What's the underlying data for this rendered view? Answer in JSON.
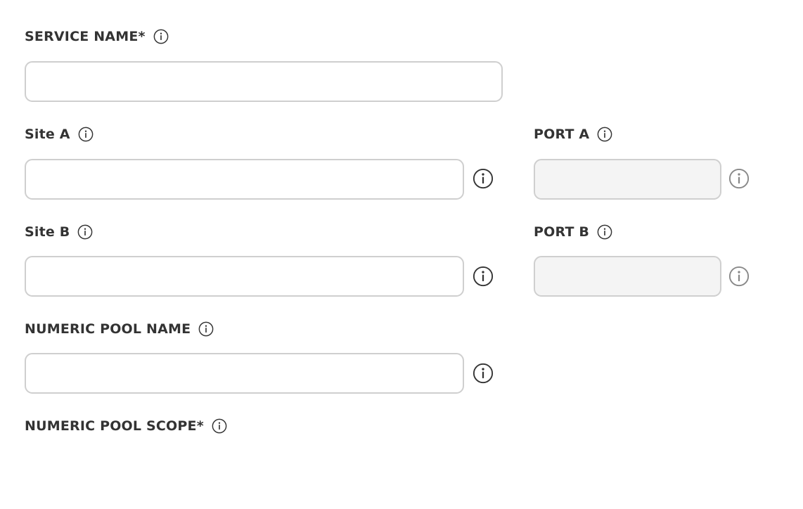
{
  "form": {
    "service_name": {
      "label": "SERVICE NAME*",
      "value": "",
      "placeholder": ""
    },
    "site_a": {
      "label": "Site A",
      "value": "",
      "placeholder": ""
    },
    "port_a": {
      "label": "PORT A",
      "value": "",
      "placeholder": "",
      "disabled": true
    },
    "site_b": {
      "label": "Site B",
      "value": "",
      "placeholder": ""
    },
    "port_b": {
      "label": "PORT B",
      "value": "",
      "placeholder": "",
      "disabled": true
    },
    "numeric_pool_name": {
      "label": "NUMERIC POOL NAME",
      "value": "",
      "placeholder": ""
    },
    "numeric_pool_scope": {
      "label": "NUMERIC POOL SCOPE*"
    }
  },
  "icons": {
    "help": "info-circle-icon"
  },
  "colors": {
    "label_text": "#333333",
    "field_border": "#cfcfcf",
    "disabled_field_bg": "#f4f4f4",
    "icon_dark": "#333333",
    "icon_muted": "#888888"
  }
}
